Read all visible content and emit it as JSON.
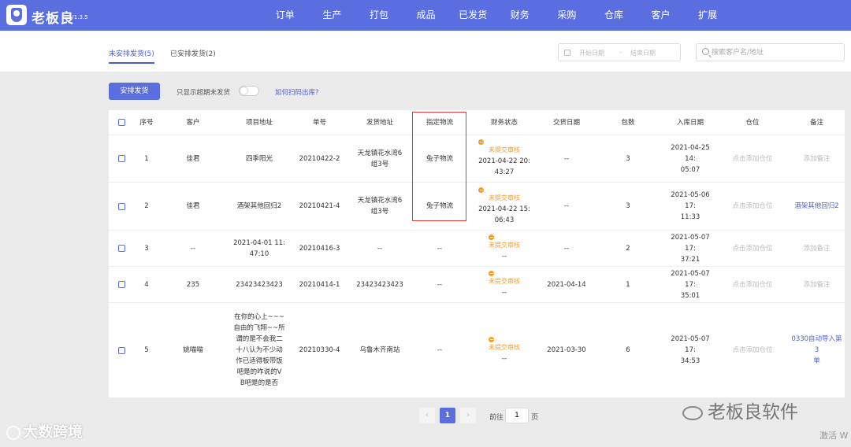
{
  "app": {
    "name": "老板良",
    "version": "V1.3.5"
  },
  "nav": [
    "订单",
    "生产",
    "打包",
    "成品",
    "已发货",
    "财务",
    "采购",
    "仓库",
    "客户",
    "扩展"
  ],
  "tabs": {
    "unarranged": "未安排发货(5)",
    "arranged": "已安排发货(2)"
  },
  "date_range": {
    "start_placeholder": "开始日期",
    "separator": "-",
    "end_placeholder": "结束日期"
  },
  "search": {
    "placeholder": "搜索客户名/地址"
  },
  "actions": {
    "arrange_button": "安排发货",
    "only_overdue_label": "只显示超期未发货",
    "only_overdue_on": false,
    "help_link": "如何扫码出库?"
  },
  "table": {
    "headers": [
      "序号",
      "客户",
      "项目地址",
      "单号",
      "发货地址",
      "指定物流",
      "财务状态",
      "交货日期",
      "包数",
      "入库日期",
      "仓位",
      "备注"
    ],
    "rows": [
      {
        "index": "1",
        "customer": "佳君",
        "project_address": [
          "四季阳光"
        ],
        "order_no": "20210422-2",
        "ship_address": [
          "天龙镇花水湾6",
          "组3号"
        ],
        "logistics": "兔子物流",
        "finance_status": "未提交审核",
        "finance_date": [
          "2021-04-22 20:",
          "43:27"
        ],
        "delivery_date": "--",
        "packages": "3",
        "stock_date": [
          "2021-04-25 14:",
          "05:07"
        ],
        "location": "点击添加仓位",
        "note": "添加备注",
        "note_is_link": false
      },
      {
        "index": "2",
        "customer": "佳君",
        "project_address": [
          "酒架其他回归2"
        ],
        "order_no": "20210421-4",
        "ship_address": [
          "天龙镇花水湾6",
          "组3号"
        ],
        "logistics": "兔子物流",
        "finance_status": "未提交审核",
        "finance_date": [
          "2021-04-22 15:",
          "06:43"
        ],
        "delivery_date": "--",
        "packages": "3",
        "stock_date": [
          "2021-05-06 17:",
          "11:33"
        ],
        "location": "点击添加仓位",
        "note": "酒架其他回归2",
        "note_is_link": true
      },
      {
        "index": "3",
        "customer": "--",
        "project_address": [
          "2021-04-01 11:",
          "47:10"
        ],
        "order_no": "20210416-3",
        "ship_address": [
          "--"
        ],
        "logistics": "--",
        "finance_status": "未提交审核",
        "finance_date": [
          "--"
        ],
        "delivery_date": "--",
        "packages": "2",
        "stock_date": [
          "2021-05-07 17:",
          "37:21"
        ],
        "location": "点击添加仓位",
        "note": "添加备注",
        "note_is_link": false
      },
      {
        "index": "4",
        "customer": "235",
        "project_address": [
          "23423423423"
        ],
        "order_no": "20210414-1",
        "ship_address": [
          "23423423423"
        ],
        "logistics": "--",
        "finance_status": "未提交审核",
        "finance_date": [
          "--"
        ],
        "delivery_date": "2021-04-14",
        "packages": "1",
        "stock_date": [
          "2021-05-07 17:",
          "35:01"
        ],
        "location": "点击添加仓位",
        "note": "添加备注",
        "note_is_link": false
      },
      {
        "index": "5",
        "customer": "姚喵喵",
        "project_address": [
          "在你的心上~~~",
          "自由的飞翔~~所",
          "谓的是不会我二",
          "十八认为不少动",
          "作已适得板带饭",
          "吧是的咋说的V",
          "B吧是的是否"
        ],
        "order_no": "20210330-4",
        "ship_address": [
          "乌鲁木齐南站"
        ],
        "logistics": "--",
        "finance_status": "未提交审核",
        "finance_date": [
          "--"
        ],
        "delivery_date": "2021-03-30",
        "packages": "6",
        "stock_date": [
          "2021-05-07 17:",
          "34:53"
        ],
        "location": "点击添加仓位",
        "note": "0330自动导入第3单",
        "note_lines": [
          "0330自动导入第3",
          "单"
        ],
        "note_is_link": true
      }
    ]
  },
  "pagination": {
    "prev": "‹",
    "current": "1",
    "next": "›",
    "goto_label": "前往",
    "goto_value": "1",
    "goto_suffix": "页"
  },
  "watermarks": {
    "left": "大数跨境",
    "right": "老板良软件",
    "activate": "激活 W"
  },
  "colors": {
    "primary": "#5b6ee0",
    "link": "#4a5fd6",
    "warning": "#f29d2c",
    "highlight": "#e23a3a"
  }
}
